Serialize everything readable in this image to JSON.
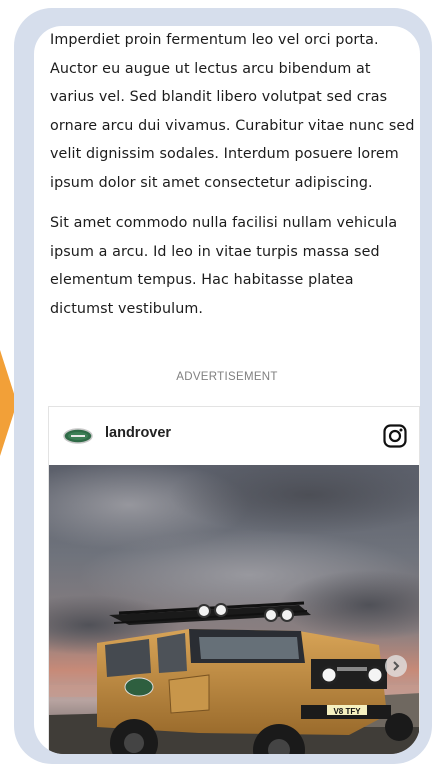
{
  "article": {
    "paragraph_1": "Imperdiet proin fermentum leo vel orci porta. Auctor eu augue ut lectus arcu bibendum at varius vel. Sed blandit libero volutpat sed cras ornare arcu dui vivamus. Curabitur vitae nunc sed velit dignissim sodales. Interdum posuere lorem ipsum dolor sit amet consectetur adipiscing.",
    "paragraph_2": "Sit amet commodo nulla facilisi nullam vehicula ipsum a arcu. Id leo in vitae turpis massa sed elementum tempus. Hac habitasse platea dictumst vestibulum."
  },
  "ad": {
    "label": "ADVERTISEMENT"
  },
  "instagram_embed": {
    "username": "landrover",
    "avatar_icon": "land-rover-oval-logo",
    "platform_icon": "instagram-icon",
    "next_icon": "chevron-right-icon",
    "license_plate": "V8 TFY"
  },
  "colors": {
    "accent_arrow": "#f2a038",
    "frame": "#d6deec",
    "text": "#1c1c1c",
    "ad_label": "#808080"
  }
}
